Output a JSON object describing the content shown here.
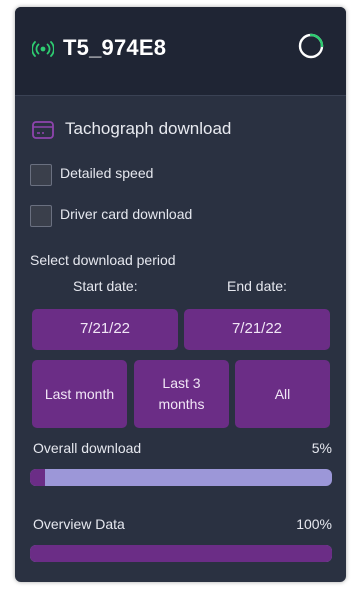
{
  "header": {
    "device_name": "T5_974E8",
    "signal_icon": "signal-broadcast-icon",
    "status_icon": "loading-spinner-icon"
  },
  "section": {
    "title": "Tachograph download",
    "icon": "card-reader-icon"
  },
  "options": {
    "detailed_speed_label": "Detailed speed",
    "driver_card_label": "Driver card download",
    "detailed_speed_checked": false,
    "driver_card_checked": false
  },
  "period": {
    "label": "Select download period",
    "start_label": "Start date:",
    "end_label": "End date:",
    "start_value": "7/21/22",
    "end_value": "7/21/22",
    "presets": [
      "Last month",
      "Last 3 months",
      "All"
    ]
  },
  "progress": [
    {
      "label": "Overall download",
      "percent_text": "5%",
      "value": 0.05
    },
    {
      "label": "Overview Data",
      "percent_text": "100%",
      "value": 1.0
    }
  ],
  "colors": {
    "accent_purple": "#6b2d86",
    "progress_track": "#9c97d8",
    "signal_green": "#2ecc71",
    "card_bg": "#2a3141"
  }
}
